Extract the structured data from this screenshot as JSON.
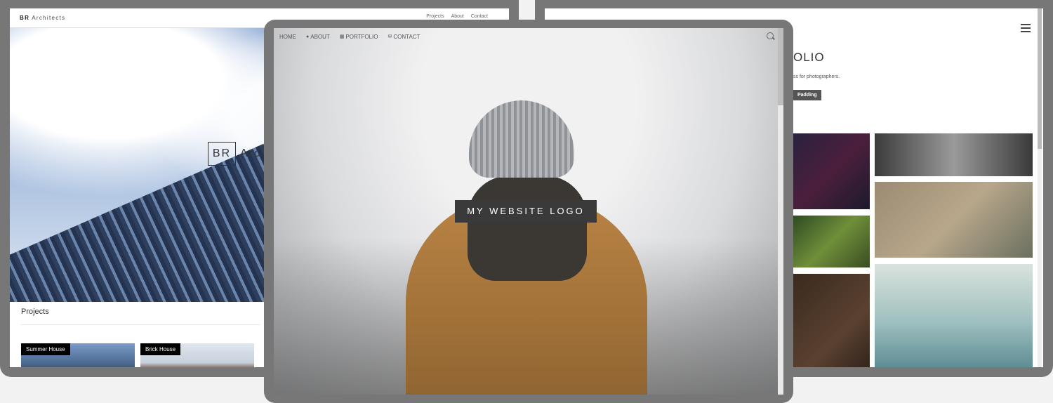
{
  "left_site": {
    "brand_bold": "BR",
    "brand_rest": " Architects",
    "nav_links": [
      "Projects",
      "About",
      "Contact"
    ],
    "hero_logo_box": "BR",
    "hero_logo_text": "Arc",
    "section_title": "Projects",
    "projects": [
      {
        "caption": "Summer House"
      },
      {
        "caption": "Brick House"
      }
    ]
  },
  "center_site": {
    "nav": [
      {
        "label": "HOME",
        "icon": ""
      },
      {
        "label": "ABOUT",
        "icon": "user-icon"
      },
      {
        "label": "PORTFOLIO",
        "icon": "grid-icon"
      },
      {
        "label": "CONTACT",
        "icon": "envelope-icon"
      }
    ],
    "logo": "MY WEBSITE LOGO"
  },
  "right_site": {
    "title_fragment": "OLIO",
    "desc_fragment": "ss for photographers.",
    "button_label": "Padding"
  }
}
